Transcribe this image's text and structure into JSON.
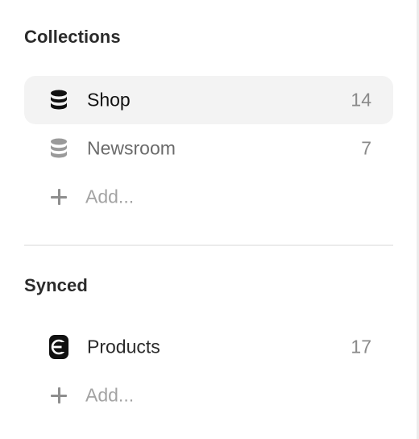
{
  "collections": {
    "title": "Collections",
    "items": [
      {
        "label": "Shop",
        "count": "14",
        "icon": "database-icon",
        "active": true
      },
      {
        "label": "Newsroom",
        "count": "7",
        "icon": "database-icon",
        "active": false
      }
    ],
    "add_label": "Add..."
  },
  "synced": {
    "title": "Synced",
    "items": [
      {
        "label": "Products",
        "count": "17",
        "icon": "app-logo-icon"
      }
    ],
    "add_label": "Add..."
  },
  "colors": {
    "active_background": "#f3f3f3",
    "divider": "#ebebeb",
    "muted_text": "#a3a3a3",
    "count_text": "#8a8a8a"
  }
}
